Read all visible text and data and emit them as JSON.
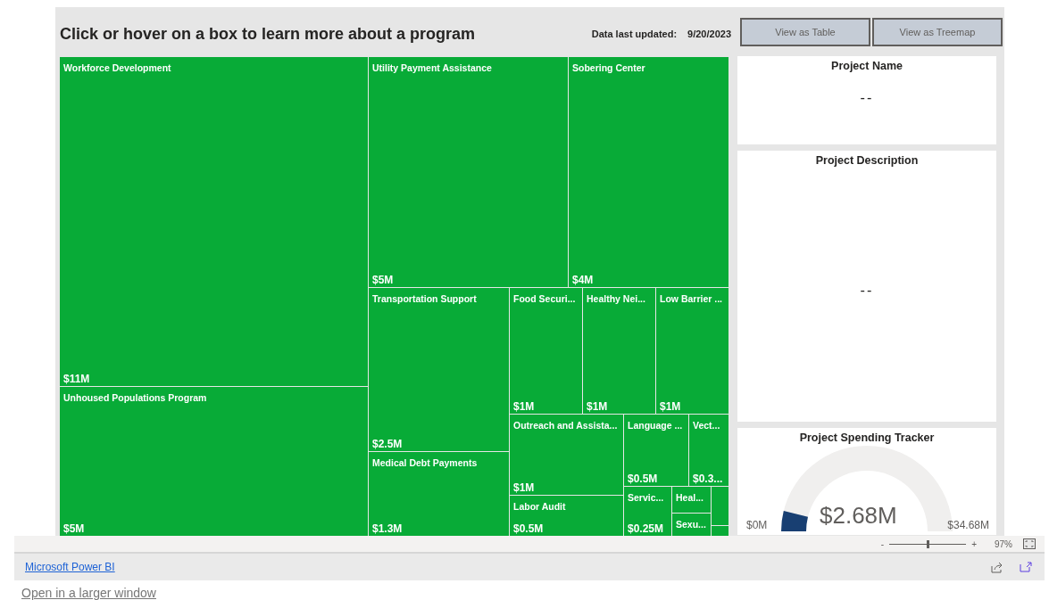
{
  "header": {
    "title": "Click or hover on a box to learn more about a program",
    "updated_label": "Data last updated:",
    "updated_value": "9/20/2023"
  },
  "view_buttons": [
    {
      "label": "View as Table"
    },
    {
      "label": "View as Treemap"
    }
  ],
  "treemap": {
    "tiles": [
      {
        "kind": "labeled",
        "lines": [
          "Workforce Development",
          "$11M"
        ]
      },
      {
        "kind": "labeled",
        "lines": [
          "Unhoused Populations Program",
          "$5M"
        ]
      },
      {
        "kind": "labeled",
        "lines": [
          "Utility Payment Assistance",
          "$5M"
        ]
      },
      {
        "kind": "labeled",
        "lines": [
          "Sobering Center",
          "$4M"
        ]
      },
      {
        "kind": "labeled",
        "lines": [
          "Transportation Support",
          "$2.5M"
        ]
      },
      {
        "kind": "labeled",
        "lines": [
          "Medical Debt Payments",
          "$1.3M"
        ]
      },
      {
        "kind": "labeled",
        "lines": [
          "Food Securi...",
          "$1M"
        ]
      },
      {
        "kind": "labeled",
        "lines": [
          "Healthy Nei...",
          "$1M"
        ]
      },
      {
        "kind": "labeled",
        "lines": [
          "Low Barrier ...",
          "$1M"
        ]
      },
      {
        "kind": "labeled",
        "lines": [
          "Outreach and Assista...",
          "$1M"
        ]
      },
      {
        "kind": "labeled",
        "lines": [
          "Labor Audit",
          "$0.5M"
        ]
      },
      {
        "kind": "labeled",
        "lines": [
          "Language ...",
          "$0.5M"
        ]
      },
      {
        "kind": "labeled",
        "lines": [
          "Vect...",
          "$0.3..."
        ]
      },
      {
        "kind": "labeled",
        "lines": [
          "Servic...",
          "$0.25M"
        ]
      },
      {
        "kind": "labeled",
        "lines": [
          "Heal..."
        ]
      },
      {
        "kind": "labeled",
        "lines": [
          "Sexu..."
        ]
      },
      {
        "kind": "blank"
      },
      {
        "kind": "blank"
      }
    ]
  },
  "project_name": {
    "title": "Project Name",
    "value": "--"
  },
  "project_description": {
    "title": "Project Description",
    "value": "--"
  },
  "spending_tracker": {
    "title": "Project Spending Tracker",
    "min": "$0M",
    "max": "$34.68M",
    "value": "$2.68M"
  },
  "zoom_bar": {
    "minus": "-",
    "plus": "+",
    "level": 0.5,
    "percent": "97%"
  },
  "footer": {
    "link": "Microsoft Power BI"
  },
  "open_link": "Open in a larger window"
}
